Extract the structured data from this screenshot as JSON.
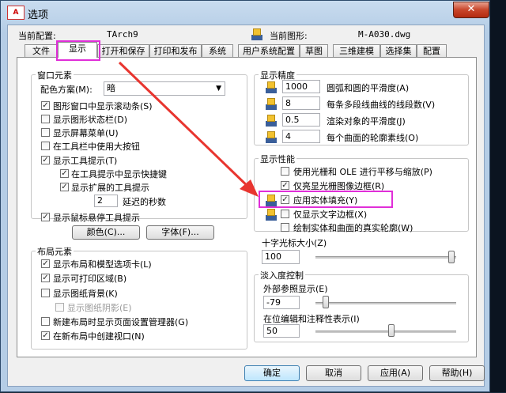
{
  "window": {
    "title": "选项",
    "app_icon_text": "A",
    "close_label": "✕"
  },
  "header": {
    "current_profile_label": "当前配置:",
    "current_profile_value": "TArch9",
    "current_drawing_label": "当前图形:",
    "current_drawing_value": "M-A030.dwg"
  },
  "tabs": [
    "文件",
    "显示",
    "打开和保存",
    "打印和发布",
    "系统",
    "用户系统配置",
    "草图",
    "三维建模",
    "选择集",
    "配置"
  ],
  "window_elements": {
    "title": "窗口元素",
    "scheme_label": "配色方案(M):",
    "scheme_value": "暗",
    "options": [
      "图形窗口中显示滚动条(S)",
      "显示图形状态栏(D)",
      "显示屏幕菜单(U)",
      "在工具栏中使用大按钮",
      "显示工具提示(T)",
      "在工具提示中显示快捷键",
      "显示扩展的工具提示",
      "延迟的秒数",
      "显示鼠标悬停工具提示"
    ],
    "delay_value": "2",
    "colors_button": "颜色(C)...",
    "fonts_button": "字体(F)..."
  },
  "layout_elements": {
    "title": "布局元素",
    "options": [
      "显示布局和模型选项卡(L)",
      "显示可打印区域(B)",
      "显示图纸背景(K)",
      "显示图纸阴影(E)",
      "新建布局时显示页面设置管理器(G)",
      "在新布局中创建视口(N)"
    ]
  },
  "display_resolution": {
    "title": "显示精度",
    "rows": [
      {
        "value": "1000",
        "label": "圆弧和圆的平滑度(A)"
      },
      {
        "value": "8",
        "label": "每条多段线曲线的线段数(V)"
      },
      {
        "value": "0.5",
        "label": "渲染对象的平滑度(J)"
      },
      {
        "value": "4",
        "label": "每个曲面的轮廓素线(O)"
      }
    ]
  },
  "display_performance": {
    "title": "显示性能",
    "options": [
      "使用光栅和 OLE 进行平移与缩放(P)",
      "仅亮显光栅图像边框(R)",
      "应用实体填充(Y)",
      "仅显示文字边框(X)",
      "绘制实体和曲面的真实轮廓(W)"
    ]
  },
  "crosshair": {
    "title": "十字光标大小(Z)",
    "value": "100",
    "level_percent": 100
  },
  "fade": {
    "title": "淡入度控制",
    "xref_label": "外部参照显示(E)",
    "xref_value": "-79",
    "inplace_label": "在位编辑和注释性表示(I)",
    "inplace_value": "50"
  },
  "buttons": {
    "ok": "确定",
    "cancel": "取消",
    "apply": "应用(A)",
    "help": "帮助(H)"
  },
  "colors": {
    "highlight": "#e02ed8",
    "arrow": "#e8352f",
    "accent": "#3c7fb1"
  }
}
